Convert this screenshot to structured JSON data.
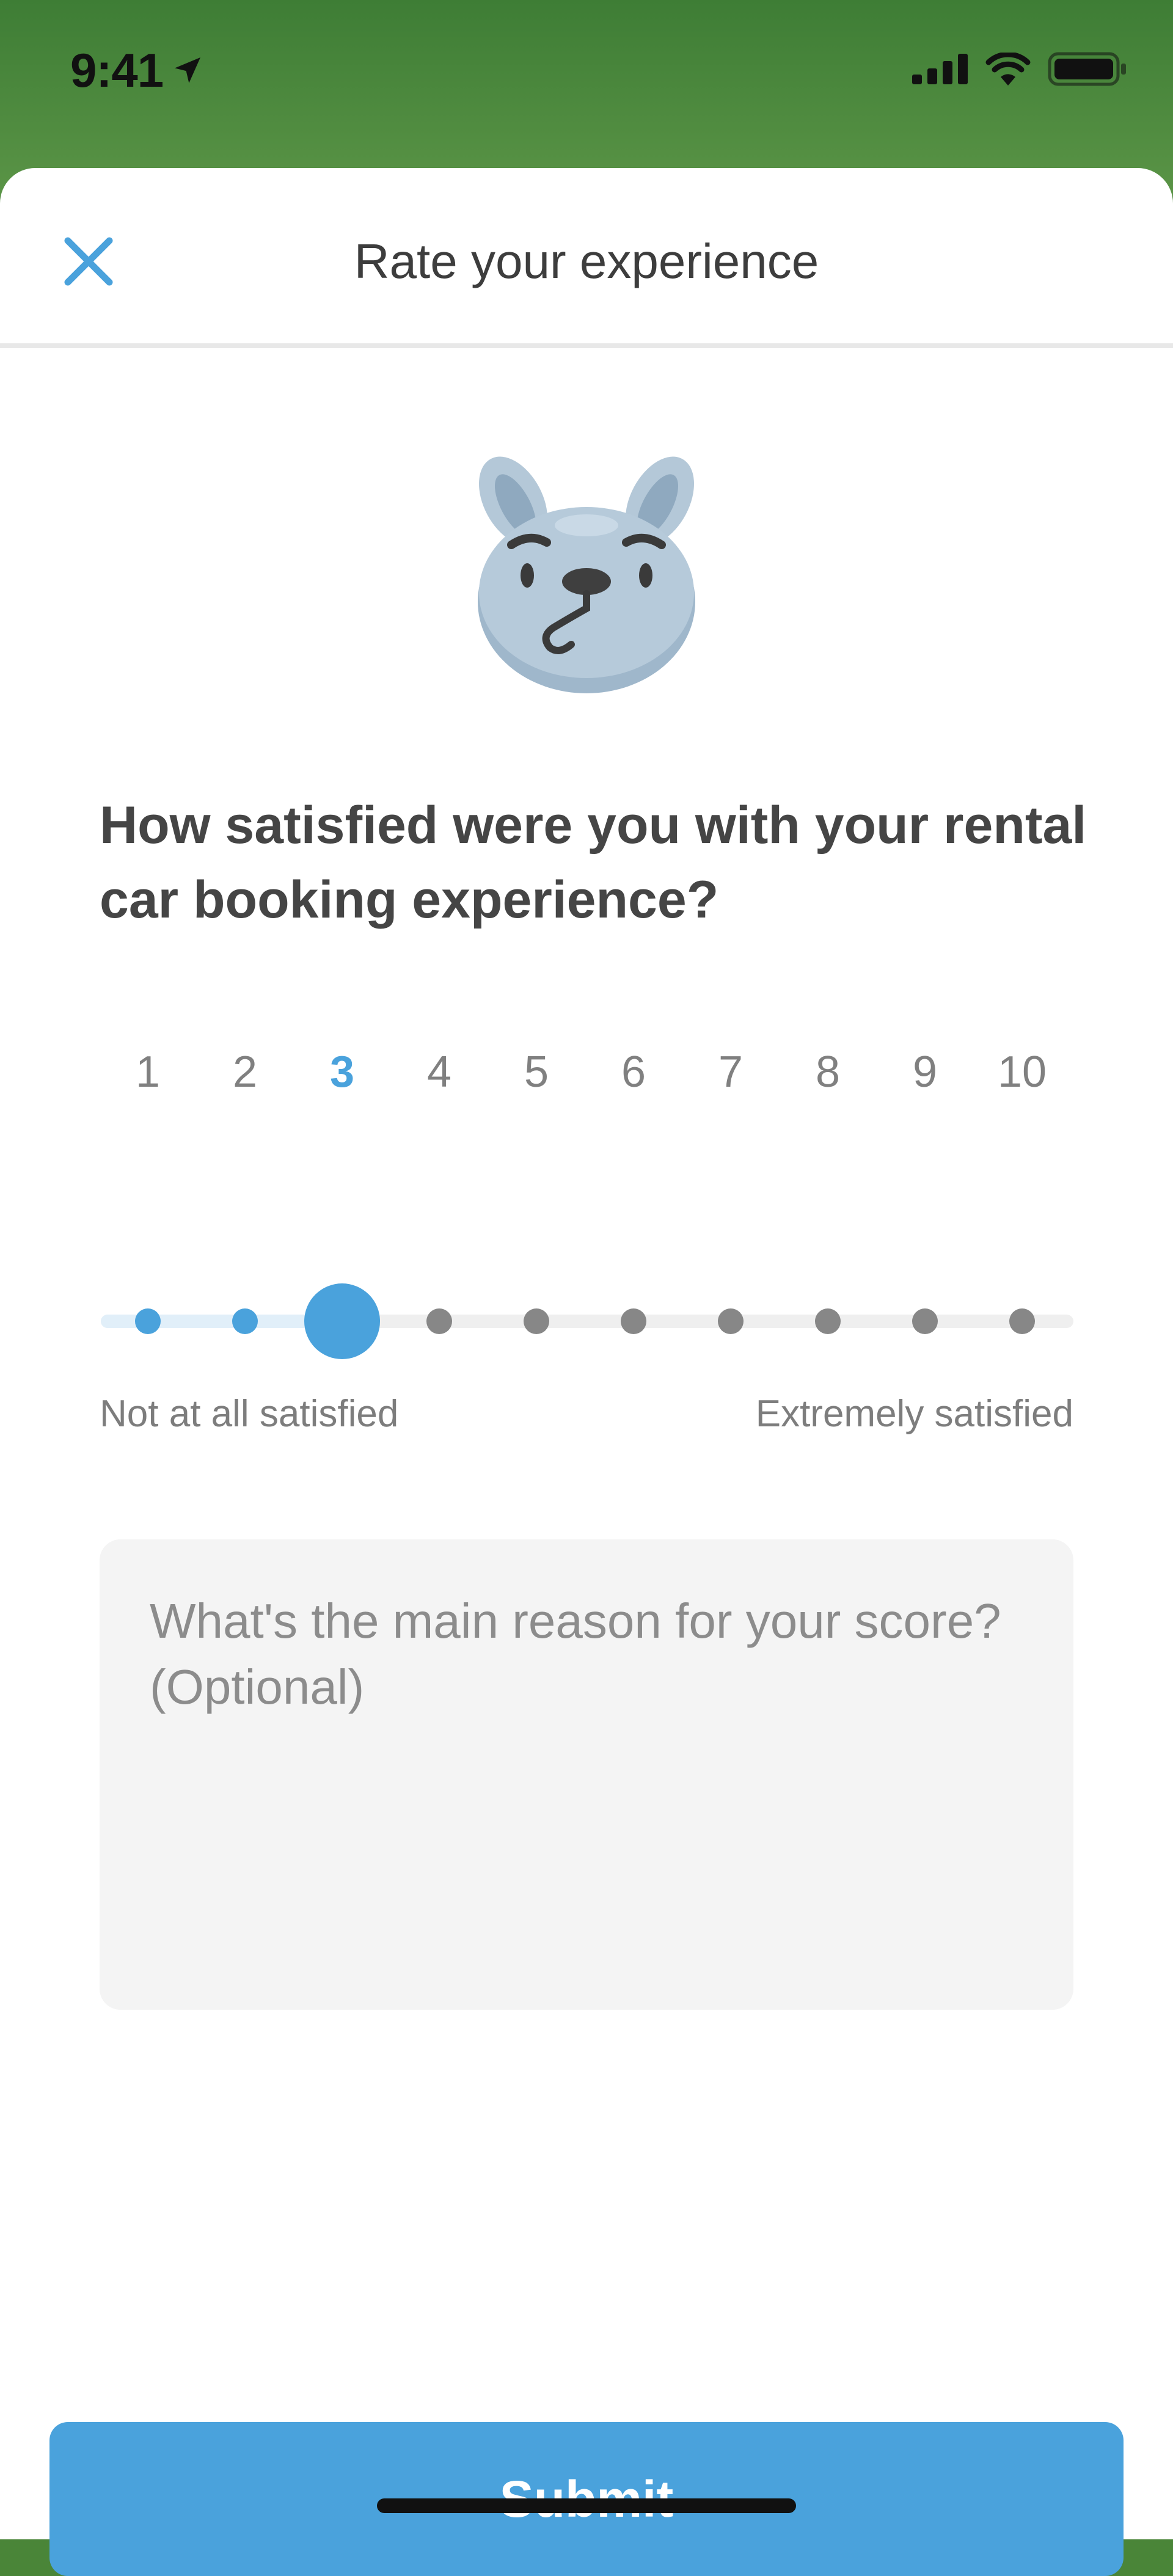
{
  "status_bar": {
    "time": "9:41",
    "icons": [
      "location-arrow-icon",
      "cellular-signal-icon",
      "wifi-icon",
      "battery-icon"
    ]
  },
  "header": {
    "title": "Rate your experience",
    "close_icon": "close-icon"
  },
  "mascot": {
    "icon": "confused-bunny-mascot"
  },
  "question": "How satisfied were you with your rental car booking experience?",
  "rating": {
    "options": [
      "1",
      "2",
      "3",
      "4",
      "5",
      "6",
      "7",
      "8",
      "9",
      "10"
    ],
    "selected": "3",
    "min_label": "Not at all satisfied",
    "max_label": "Extremely satisfied"
  },
  "reason": {
    "placeholder": "What's the main reason for your score? (Optional)",
    "value": ""
  },
  "submit": {
    "label": "Submit"
  },
  "colors": {
    "accent": "#4aa2dc",
    "header_green": "#4a8538",
    "inactive_dot": "#878787"
  }
}
